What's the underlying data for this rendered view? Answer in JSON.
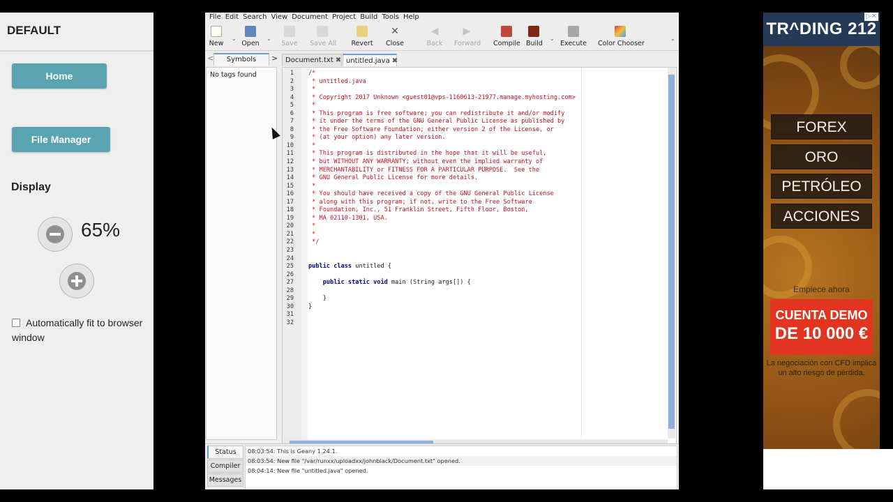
{
  "left_panel": {
    "title": "DEFAULT",
    "home_label": "Home",
    "file_manager_label": "File Manager",
    "display_label": "Display",
    "zoom_value": "65%",
    "autofit_label": "Automatically fit to browser window"
  },
  "geany": {
    "menu": [
      "File",
      "Edit",
      "Search",
      "View",
      "Document",
      "Project",
      "Build",
      "Tools",
      "Help"
    ],
    "toolbar": {
      "new": "New",
      "open": "Open",
      "save": "Save",
      "save_all": "Save All",
      "revert": "Revert",
      "close": "Close",
      "back": "Back",
      "forward": "Forward",
      "compile": "Compile",
      "build": "Build",
      "execute": "Execute",
      "color_chooser": "Color Chooser"
    },
    "sidebar_tab": "Symbols",
    "no_tags": "No tags found",
    "tabs": [
      "Document.txt",
      "untitled.java"
    ],
    "code": [
      {
        "n": "1",
        "t": "/*",
        "c": "cmt"
      },
      {
        "n": "2",
        "t": " * untitled.java",
        "c": "cmt"
      },
      {
        "n": "3",
        "t": " *",
        "c": "cmt"
      },
      {
        "n": "4",
        "t": " * Copyright 2017 Unknown <guest01@vps-1160613-21977.manage.myhosting.com>",
        "c": "cmt"
      },
      {
        "n": "5",
        "t": " *",
        "c": "cmt"
      },
      {
        "n": "6",
        "t": " * This program is free software; you can redistribute it and/or modify",
        "c": "cmt"
      },
      {
        "n": "7",
        "t": " * it under the terms of the GNU General Public License as published by",
        "c": "cmt"
      },
      {
        "n": "8",
        "t": " * the Free Software Foundation; either version 2 of the License, or",
        "c": "cmt"
      },
      {
        "n": "9",
        "t": " * (at your option) any later version.",
        "c": "cmt"
      },
      {
        "n": "10",
        "t": " *",
        "c": "cmt"
      },
      {
        "n": "11",
        "t": " * This program is distributed in the hope that it will be useful,",
        "c": "cmt"
      },
      {
        "n": "12",
        "t": " * but WITHOUT ANY WARRANTY; without even the implied warranty of",
        "c": "cmt"
      },
      {
        "n": "13",
        "t": " * MERCHANTABILITY or FITNESS FOR A PARTICULAR PURPOSE.  See the",
        "c": "cmt"
      },
      {
        "n": "14",
        "t": " * GNU General Public License for more details.",
        "c": "cmt"
      },
      {
        "n": "15",
        "t": " *",
        "c": "cmt"
      },
      {
        "n": "16",
        "t": " * You should have received a copy of the GNU General Public License",
        "c": "cmt"
      },
      {
        "n": "17",
        "t": " * along with this program; if not, write to the Free Software",
        "c": "cmt"
      },
      {
        "n": "18",
        "t": " * Foundation, Inc., 51 Franklin Street, Fifth Floor, Boston,",
        "c": "cmt"
      },
      {
        "n": "19",
        "t": " * MA 02110-1301, USA.",
        "c": "cmt"
      },
      {
        "n": "20",
        "t": " *",
        "c": "cmt"
      },
      {
        "n": "21",
        "t": " *",
        "c": "cmt"
      },
      {
        "n": "22",
        "t": " */",
        "c": "cmt"
      },
      {
        "n": "23",
        "t": "",
        "c": "pl"
      },
      {
        "n": "24",
        "t": "",
        "c": "pl"
      },
      {
        "n": "25",
        "parts": [
          {
            "t": "public class",
            "c": "kw"
          },
          {
            "t": " untitled {",
            "c": "pl"
          }
        ]
      },
      {
        "n": "26",
        "t": "",
        "c": "pl"
      },
      {
        "n": "27",
        "parts": [
          {
            "t": "    public static void",
            "c": "kw"
          },
          {
            "t": " main (String args[]) {",
            "c": "pl"
          }
        ]
      },
      {
        "n": "28",
        "t": "",
        "c": "pl"
      },
      {
        "n": "29",
        "t": "    }",
        "c": "pl"
      },
      {
        "n": "30",
        "t": "}",
        "c": "pl"
      },
      {
        "n": "31",
        "t": "",
        "c": "pl"
      },
      {
        "n": "32",
        "t": "",
        "c": "pl"
      }
    ],
    "msg_tabs": [
      "Status",
      "Compiler",
      "Messages"
    ],
    "messages": [
      "08:03:54: This is Geany 1.24.1.",
      "08:03:54: New file \"/var/runxx/uploadxx/johnblack/Document.txt\" opened.",
      "08:04:14: New file \"untitled.java\" opened."
    ]
  },
  "ad": {
    "brand": "TR^DING 212",
    "items": [
      "FOREX",
      "ORO",
      "PETRÓLEO",
      "ACCIONES"
    ],
    "empiece": "Empiece ahora",
    "cta_line1": "CUENTA DEMO",
    "cta_line2": "DE 10 000 €",
    "disclaimer": "La negociación con CFD implica un alto riesgo de pérdida."
  },
  "colors": {
    "button_teal": "#5aa4b1",
    "comment_red": "#c8101e",
    "keyword_blue": "#00007f",
    "ad_cta_red": "#e2341f",
    "ad_brand_navy": "#253a57"
  }
}
